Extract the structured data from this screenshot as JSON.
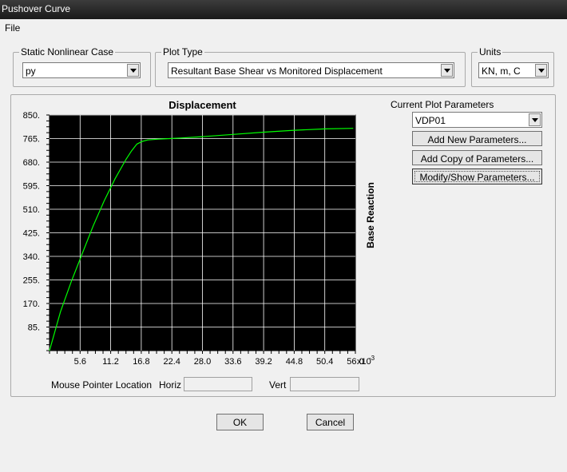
{
  "window": {
    "title": "Pushover Curve"
  },
  "menu": {
    "file": "File"
  },
  "static_case": {
    "label": "Static Nonlinear Case",
    "value": "py"
  },
  "plot_type": {
    "label": "Plot Type",
    "value": "Resultant Base Shear vs Monitored Displacement"
  },
  "units": {
    "label": "Units",
    "value": "KN, m, C"
  },
  "params": {
    "label": "Current Plot Parameters",
    "value": "VDP01",
    "add_new": "Add New Parameters...",
    "add_copy": "Add Copy of Parameters...",
    "modify": "Modify/Show Parameters..."
  },
  "pointer": {
    "label": "Mouse Pointer Location",
    "horiz_label": "Horiz",
    "vert_label": "Vert",
    "horiz_value": "",
    "vert_value": ""
  },
  "buttons": {
    "ok": "OK",
    "cancel": "Cancel"
  },
  "chart_data": {
    "type": "line",
    "title": "Displacement",
    "ylabel": "Base Reaction",
    "x_exponent": "x10",
    "x_exponent_power": "-3",
    "x_ticks": [
      "5.6",
      "11.2",
      "16.8",
      "22.4",
      "28.0",
      "33.6",
      "39.2",
      "44.8",
      "50.4",
      "56.0"
    ],
    "x_tick_values": [
      5.6,
      11.2,
      16.8,
      22.4,
      28.0,
      33.6,
      39.2,
      44.8,
      50.4,
      56.0
    ],
    "y_ticks": [
      "850.",
      "765.",
      "680.",
      "595.",
      "510.",
      "425.",
      "340.",
      "255.",
      "170.",
      "85."
    ],
    "y_tick_values": [
      850,
      765,
      680,
      595,
      510,
      425,
      340,
      255,
      170,
      85
    ],
    "xlim": [
      0,
      56.0
    ],
    "ylim": [
      0,
      850
    ],
    "grid": true,
    "background": "#000000",
    "grid_color": "#ffffff",
    "line_color": "#00ff00",
    "series": [
      {
        "x": [
          0,
          2,
          4,
          6,
          8,
          10,
          12,
          14,
          15,
          16,
          17,
          18,
          20,
          22,
          24,
          28,
          33.6,
          39.2,
          44.8,
          50.4,
          55.6
        ],
        "y": [
          0,
          140,
          250,
          350,
          450,
          540,
          620,
          690,
          720,
          745,
          755,
          760,
          763,
          765,
          767,
          772,
          780,
          788,
          795,
          800,
          802
        ]
      }
    ]
  }
}
